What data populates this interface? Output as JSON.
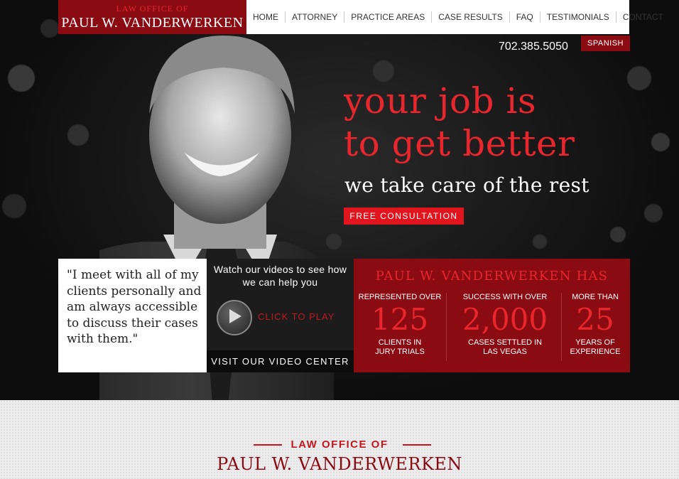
{
  "logo": {
    "small": "LAW OFFICE OF",
    "big": "PAUL W. VANDERWERKEN"
  },
  "nav": [
    "HOME",
    "ATTORNEY",
    "PRACTICE AREAS",
    "CASE RESULTS",
    "FAQ",
    "TESTIMONIALS",
    "CONTACT"
  ],
  "phone": "702.385.5050",
  "language_button": "SPANISH",
  "hero": {
    "line1": "your job is",
    "line2": "to get better",
    "subline": "we take care of the rest",
    "cta": "FREE CONSULTATION"
  },
  "quote": "\"I meet with all of my clients personally and am always accessible to discuss their cases with them.\"",
  "video": {
    "heading": "Watch our videos to see how we can help you",
    "play_label": "CLICK TO PLAY",
    "center_link": "VISIT OUR VIDEO CENTER"
  },
  "stats": {
    "title": "PAUL W. VANDERWERKEN HAS",
    "items": [
      {
        "top": "REPRESENTED OVER",
        "number": "125",
        "bottom": "CLIENTS IN JURY TRIALS"
      },
      {
        "top": "SUCCESS WITH OVER",
        "number": "2,000",
        "bottom": "CASES SETTLED IN LAS VEGAS"
      },
      {
        "top": "MORE THAN",
        "number": "25",
        "bottom": "YEARS OF EXPERIENCE"
      }
    ]
  },
  "footer_brand": {
    "small": "LAW OFFICE OF",
    "big": "PAUL W. VANDERWERKEN"
  },
  "colors": {
    "brand_red": "#8b0b12",
    "accent_red": "#e8262e"
  }
}
